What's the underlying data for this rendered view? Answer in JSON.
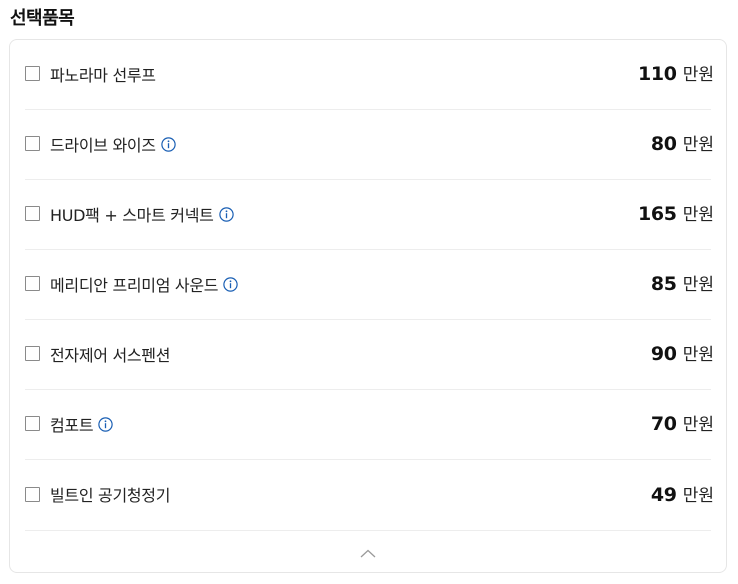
{
  "section": {
    "title": "선택품목"
  },
  "options": [
    {
      "label": "파노라마 선루프",
      "price": "110",
      "unit": "만원",
      "info": false
    },
    {
      "label": "드라이브 와이즈",
      "price": "80",
      "unit": "만원",
      "info": true
    },
    {
      "label": "HUD팩 + 스마트 커넥트",
      "price": "165",
      "unit": "만원",
      "info": true
    },
    {
      "label": "메리디안 프리미엄 사운드",
      "price": "85",
      "unit": "만원",
      "info": true
    },
    {
      "label": "전자제어 서스펜션",
      "price": "90",
      "unit": "만원",
      "info": false
    },
    {
      "label": "컴포트",
      "price": "70",
      "unit": "만원",
      "info": true
    },
    {
      "label": "빌트인 공기청정기",
      "price": "49",
      "unit": "만원",
      "info": false
    }
  ],
  "colors": {
    "info_icon": "#1a5fb4",
    "checkbox_border": "#8a8a8a",
    "divider": "#ededed"
  },
  "icons": {
    "info": "info-circle-icon",
    "collapse": "chevron-up-icon"
  }
}
